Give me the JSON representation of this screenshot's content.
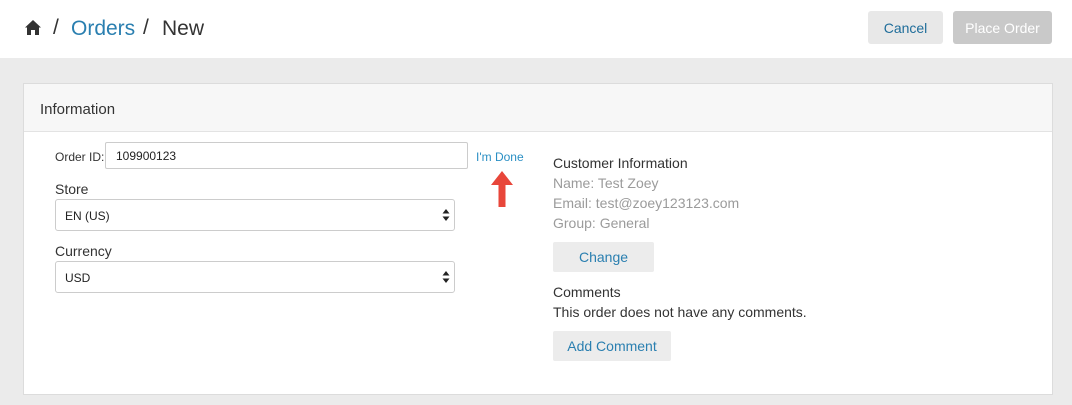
{
  "breadcrumb": {
    "home_icon": "home-icon",
    "separator": "/",
    "orders_link": "Orders",
    "current": "New"
  },
  "header_actions": {
    "cancel_label": "Cancel",
    "place_order_label": "Place Order"
  },
  "panel": {
    "title": "Information"
  },
  "form": {
    "order_id_label": "Order ID:",
    "order_id_value": "109900123",
    "done_link": "I'm Done",
    "store_label": "Store",
    "store_value": "EN (US)",
    "currency_label": "Currency",
    "currency_value": "USD"
  },
  "customer": {
    "title": "Customer Information",
    "name": "Name: Test Zoey",
    "email": "Email: test@zoey123123.com",
    "group": "Group: General",
    "change_label": "Change"
  },
  "comments": {
    "title": "Comments",
    "empty_text": "This order does not have any comments.",
    "add_label": "Add Comment"
  },
  "colors": {
    "link": "#2a7fb0",
    "annotation_arrow": "#e8463a",
    "disabled_button": "#c9c9c9"
  }
}
